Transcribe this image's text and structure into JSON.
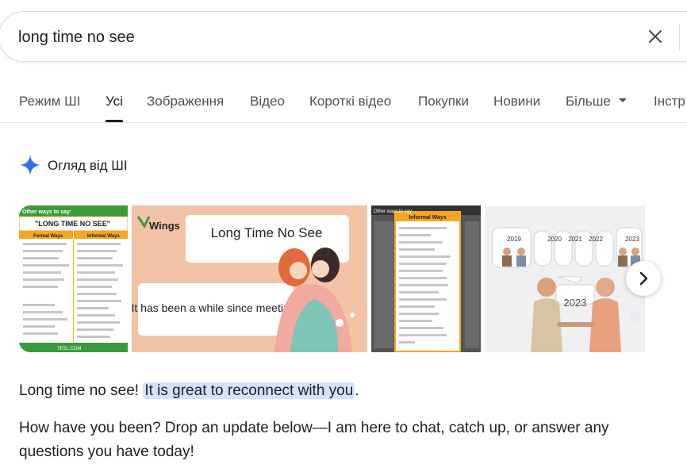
{
  "search": {
    "query": "long time no see",
    "clear_label": "Clear"
  },
  "tabs": [
    {
      "label": "Режим ШІ"
    },
    {
      "label": "Усі"
    },
    {
      "label": "Зображення"
    },
    {
      "label": "Відео"
    },
    {
      "label": "Короткі відео"
    },
    {
      "label": "Покупки"
    },
    {
      "label": "Новини"
    },
    {
      "label": "Більше"
    },
    {
      "label": "Інстр"
    }
  ],
  "ai_overview": {
    "title": "Огляд від ШІ",
    "icon": "sparkle-icon"
  },
  "images": {
    "thumb1": {
      "banner": "Other ways to say:",
      "title": "\"LONG TIME NO SEE\"",
      "col1": "Formal Ways",
      "col2": "Informal Ways",
      "footer": "7ESL.COM"
    },
    "thumb2": {
      "logo": "Wings",
      "phrase": "Long Time No See",
      "caption": "It has been a while since meeting"
    },
    "thumb3": {
      "banner": "Other ways to say",
      "col": "Informal Ways"
    },
    "thumb4": {
      "years": [
        "2019",
        "2020",
        "2021",
        "2022",
        "2023"
      ],
      "big_year": "2023"
    },
    "next_icon": "chevron-right-icon"
  },
  "answer": {
    "plain": "Long time no see! ",
    "highlight": "It is great to reconnect with you",
    "end": ".",
    "paragraph2": "How have you been? Drop an update below—I am here to chat, catch up, or answer any questions you have today!"
  },
  "colors": {
    "highlight": "#d3e3fd",
    "green": "#3a9b3a",
    "orange": "#f5a623",
    "peach": "#f2c3a5"
  }
}
